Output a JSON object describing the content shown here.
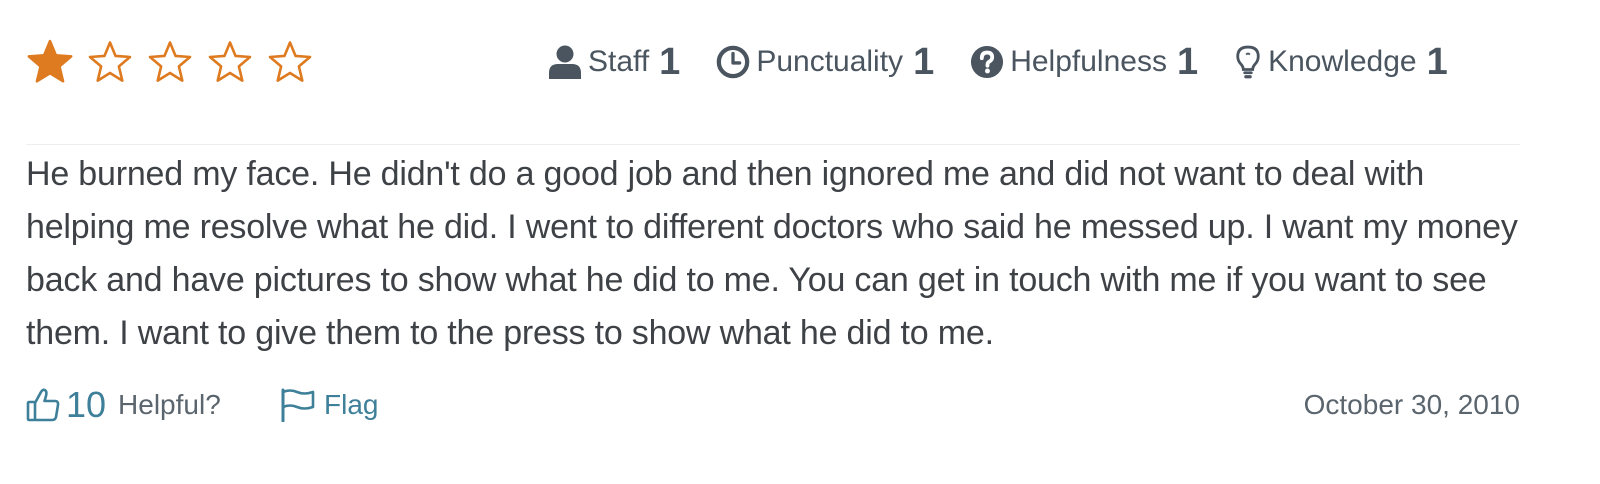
{
  "rating": {
    "value": 1,
    "max": 5,
    "filled_color": "#de7a1f",
    "empty_color": "#de7a1f"
  },
  "categories": [
    {
      "icon": "user-icon",
      "label": "Staff",
      "score": "1"
    },
    {
      "icon": "clock-icon",
      "label": "Punctuality",
      "score": "1"
    },
    {
      "icon": "question-circle-icon",
      "label": "Helpfulness",
      "score": "1"
    },
    {
      "icon": "lightbulb-icon",
      "label": "Knowledge",
      "score": "1"
    }
  ],
  "review": {
    "text": "He burned my face. He didn't do a good job and then ignored me and did not want to deal with helping me resolve what he did. I went to different doctors who said he messed up. I want my money back and have pictures to show what he did to me. You can get in touch with me if you want to see them. I want to give them to the press to show what he did to me."
  },
  "footer": {
    "helpful_icon": "thumbs-up-icon",
    "helpful_count": "10",
    "helpful_label": "Helpful?",
    "flag_icon": "flag-icon",
    "flag_label": "Flag",
    "date": "October 30, 2010"
  },
  "colors": {
    "accent": "#3e7f9a",
    "text": "#3e4246",
    "muted": "#5b656e",
    "star": "#de7a1f"
  }
}
